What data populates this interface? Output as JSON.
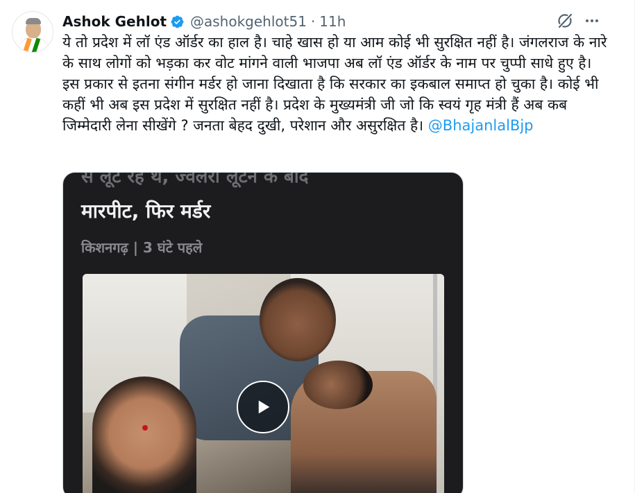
{
  "author": {
    "name": "Ashok Gehlot",
    "handle": "@ashokgehlot51",
    "separator": "·",
    "time": "11h"
  },
  "icons": {
    "verified": "verified-badge-icon",
    "grok": "grok-icon",
    "more": "more-icon",
    "play": "play-icon"
  },
  "colors": {
    "verified": "#1d9bf0",
    "mention": "#1d9bf0",
    "text": "#0f1419",
    "secondary": "#536471"
  },
  "tweet": {
    "text": "ये तो प्रदेश में लॉ एंड ऑर्डर का हाल है। चाहे खास हो या आम कोई भी सुरक्षित नहीं है। जंगलराज के नारे के साथ लोगों को भड़का कर वोट मांगने वाली भाजपा अब लॉ एंड ऑर्डर के नाम पर चुप्पी साधे हुए है। इस प्रकार से इतना संगीन मर्डर हो जाना दिखाता है कि सरकार का इकबाल समाप्त हो चुका है। कोई भी कहीं भी अब इस प्रदेश में सुरक्षित नहीं है। प्रदेश के मुख्यमंत्री जी जो कि स्वयं गृह मंत्री हैं अब कब जिम्मेदारी लेना सीखेंगे ? जनता बेहद दुखी, परेशान और असुरक्षित है। ",
    "mention": "@BhajanlalBjp"
  },
  "media": {
    "top_cut_text": "से लूट रहे थे, ज्वेलरी लूटने के बाद",
    "headline": "मारपीट, फिर मर्डर",
    "meta": "किशनगढ़ | 3 घंटे पहले"
  }
}
